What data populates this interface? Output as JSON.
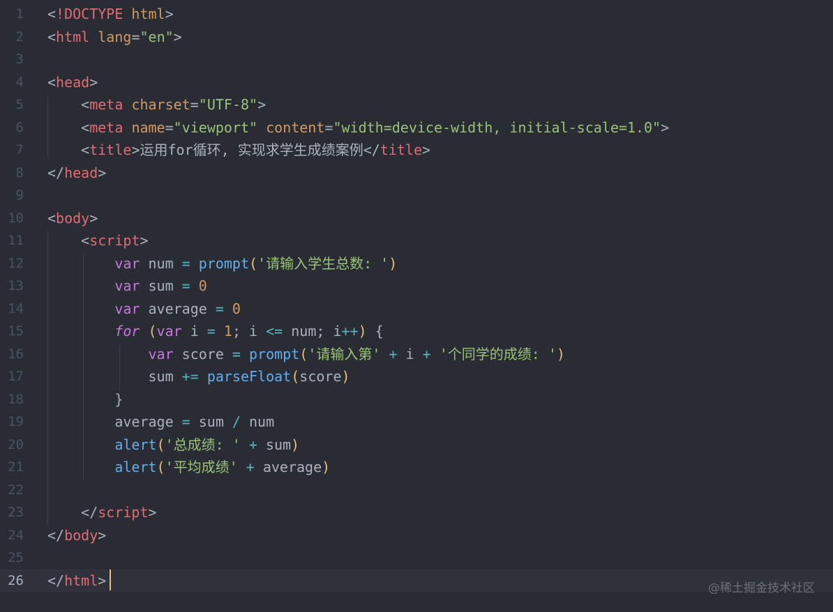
{
  "editor": {
    "active_line": 26,
    "lines": [
      {
        "n": "1",
        "tokens": [
          [
            "punct",
            "<"
          ],
          [
            "doctype",
            "!DOCTYPE"
          ],
          [
            "punct",
            " "
          ],
          [
            "attr",
            "html"
          ],
          [
            "punct",
            ">"
          ]
        ]
      },
      {
        "n": "2",
        "tokens": [
          [
            "punct",
            "<"
          ],
          [
            "tag",
            "html"
          ],
          [
            "punct",
            " "
          ],
          [
            "attr",
            "lang"
          ],
          [
            "punct",
            "="
          ],
          [
            "str",
            "\"en\""
          ],
          [
            "punct",
            ">"
          ]
        ]
      },
      {
        "n": "3",
        "tokens": []
      },
      {
        "n": "4",
        "tokens": [
          [
            "punct",
            "<"
          ],
          [
            "tag",
            "head"
          ],
          [
            "punct",
            ">"
          ]
        ]
      },
      {
        "n": "5",
        "tokens": [
          [
            "punct",
            "    <"
          ],
          [
            "tag",
            "meta"
          ],
          [
            "punct",
            " "
          ],
          [
            "attr",
            "charset"
          ],
          [
            "punct",
            "="
          ],
          [
            "str",
            "\"UTF-8\""
          ],
          [
            "punct",
            ">"
          ]
        ]
      },
      {
        "n": "6",
        "tokens": [
          [
            "punct",
            "    <"
          ],
          [
            "tag",
            "meta"
          ],
          [
            "punct",
            " "
          ],
          [
            "attr",
            "name"
          ],
          [
            "punct",
            "="
          ],
          [
            "str",
            "\"viewport\""
          ],
          [
            "punct",
            " "
          ],
          [
            "attr",
            "content"
          ],
          [
            "punct",
            "="
          ],
          [
            "str",
            "\"width=device-width, initial-scale=1.0\""
          ],
          [
            "punct",
            ">"
          ]
        ]
      },
      {
        "n": "7",
        "tokens": [
          [
            "punct",
            "    <"
          ],
          [
            "tag",
            "title"
          ],
          [
            "punct",
            ">"
          ],
          [
            "text",
            "运用for循环, 实现求学生成绩案例"
          ],
          [
            "punct",
            "</"
          ],
          [
            "tag",
            "title"
          ],
          [
            "punct",
            ">"
          ]
        ]
      },
      {
        "n": "8",
        "tokens": [
          [
            "punct",
            "</"
          ],
          [
            "tag",
            "head"
          ],
          [
            "punct",
            ">"
          ]
        ]
      },
      {
        "n": "9",
        "tokens": []
      },
      {
        "n": "10",
        "tokens": [
          [
            "punct",
            "<"
          ],
          [
            "tag",
            "body"
          ],
          [
            "punct",
            ">"
          ]
        ]
      },
      {
        "n": "11",
        "tokens": [
          [
            "punct",
            "    <"
          ],
          [
            "tag",
            "script"
          ],
          [
            "punct",
            ">"
          ]
        ]
      },
      {
        "n": "12",
        "tokens": [
          [
            "punct",
            "        "
          ],
          [
            "kw",
            "var"
          ],
          [
            "var",
            " num "
          ],
          [
            "op",
            "="
          ],
          [
            "var",
            " "
          ],
          [
            "fn",
            "prompt"
          ],
          [
            "paren",
            "("
          ],
          [
            "str",
            "'请输入学生总数: '"
          ],
          [
            "paren",
            ")"
          ]
        ]
      },
      {
        "n": "13",
        "tokens": [
          [
            "punct",
            "        "
          ],
          [
            "kw",
            "var"
          ],
          [
            "var",
            " sum "
          ],
          [
            "op",
            "="
          ],
          [
            "var",
            " "
          ],
          [
            "num",
            "0"
          ]
        ]
      },
      {
        "n": "14",
        "tokens": [
          [
            "punct",
            "        "
          ],
          [
            "kw",
            "var"
          ],
          [
            "var",
            " average "
          ],
          [
            "op",
            "="
          ],
          [
            "var",
            " "
          ],
          [
            "num",
            "0"
          ]
        ]
      },
      {
        "n": "15",
        "tokens": [
          [
            "punct",
            "        "
          ],
          [
            "kwit",
            "for"
          ],
          [
            "var",
            " "
          ],
          [
            "paren",
            "("
          ],
          [
            "kw",
            "var"
          ],
          [
            "var",
            " i "
          ],
          [
            "op",
            "="
          ],
          [
            "var",
            " "
          ],
          [
            "num",
            "1"
          ],
          [
            "var",
            "; i "
          ],
          [
            "op",
            "<="
          ],
          [
            "var",
            " num; i"
          ],
          [
            "op",
            "++"
          ],
          [
            "paren",
            ")"
          ],
          [
            "var",
            " {"
          ]
        ]
      },
      {
        "n": "16",
        "tokens": [
          [
            "punct",
            "            "
          ],
          [
            "kw",
            "var"
          ],
          [
            "var",
            " score "
          ],
          [
            "op",
            "="
          ],
          [
            "var",
            " "
          ],
          [
            "fn",
            "prompt"
          ],
          [
            "paren",
            "("
          ],
          [
            "str",
            "'请输入第'"
          ],
          [
            "var",
            " "
          ],
          [
            "op",
            "+"
          ],
          [
            "var",
            " i "
          ],
          [
            "op",
            "+"
          ],
          [
            "var",
            " "
          ],
          [
            "str",
            "'个同学的成绩: '"
          ],
          [
            "paren",
            ")"
          ]
        ]
      },
      {
        "n": "17",
        "tokens": [
          [
            "punct",
            "            "
          ],
          [
            "var",
            "sum "
          ],
          [
            "op",
            "+="
          ],
          [
            "var",
            " "
          ],
          [
            "fn",
            "parseFloat"
          ],
          [
            "paren",
            "("
          ],
          [
            "var",
            "score"
          ],
          [
            "paren",
            ")"
          ]
        ]
      },
      {
        "n": "18",
        "tokens": [
          [
            "punct",
            "        "
          ],
          [
            "var",
            "}"
          ]
        ]
      },
      {
        "n": "19",
        "tokens": [
          [
            "punct",
            "        "
          ],
          [
            "var",
            "average "
          ],
          [
            "op",
            "="
          ],
          [
            "var",
            " sum "
          ],
          [
            "op",
            "/"
          ],
          [
            "var",
            " num"
          ]
        ]
      },
      {
        "n": "20",
        "tokens": [
          [
            "punct",
            "        "
          ],
          [
            "fn",
            "alert"
          ],
          [
            "paren",
            "("
          ],
          [
            "str",
            "'总成绩: '"
          ],
          [
            "var",
            " "
          ],
          [
            "op",
            "+"
          ],
          [
            "var",
            " sum"
          ],
          [
            "paren",
            ")"
          ]
        ]
      },
      {
        "n": "21",
        "tokens": [
          [
            "punct",
            "        "
          ],
          [
            "fn",
            "alert"
          ],
          [
            "paren",
            "("
          ],
          [
            "str",
            "'平均成绩'"
          ],
          [
            "var",
            " "
          ],
          [
            "op",
            "+"
          ],
          [
            "var",
            " average"
          ],
          [
            "paren",
            ")"
          ]
        ]
      },
      {
        "n": "22",
        "tokens": []
      },
      {
        "n": "23",
        "tokens": [
          [
            "punct",
            "    </"
          ],
          [
            "tag",
            "script"
          ],
          [
            "punct",
            ">"
          ]
        ]
      },
      {
        "n": "24",
        "tokens": [
          [
            "punct",
            "</"
          ],
          [
            "tag",
            "body"
          ],
          [
            "punct",
            ">"
          ]
        ]
      },
      {
        "n": "25",
        "tokens": []
      },
      {
        "n": "26",
        "tokens": [
          [
            "punct",
            "</"
          ],
          [
            "tag",
            "html"
          ],
          [
            "punct",
            ">"
          ]
        ]
      }
    ]
  },
  "watermark": "@稀土掘金技术社区",
  "colors": {
    "background": "#2a2c33",
    "tag": "#e06c75",
    "attribute": "#d19a66",
    "string": "#98c379",
    "keyword": "#c678dd",
    "function": "#61afef",
    "number": "#d19a66",
    "operator": "#56b6c2",
    "cursor": "#e5c07b"
  }
}
